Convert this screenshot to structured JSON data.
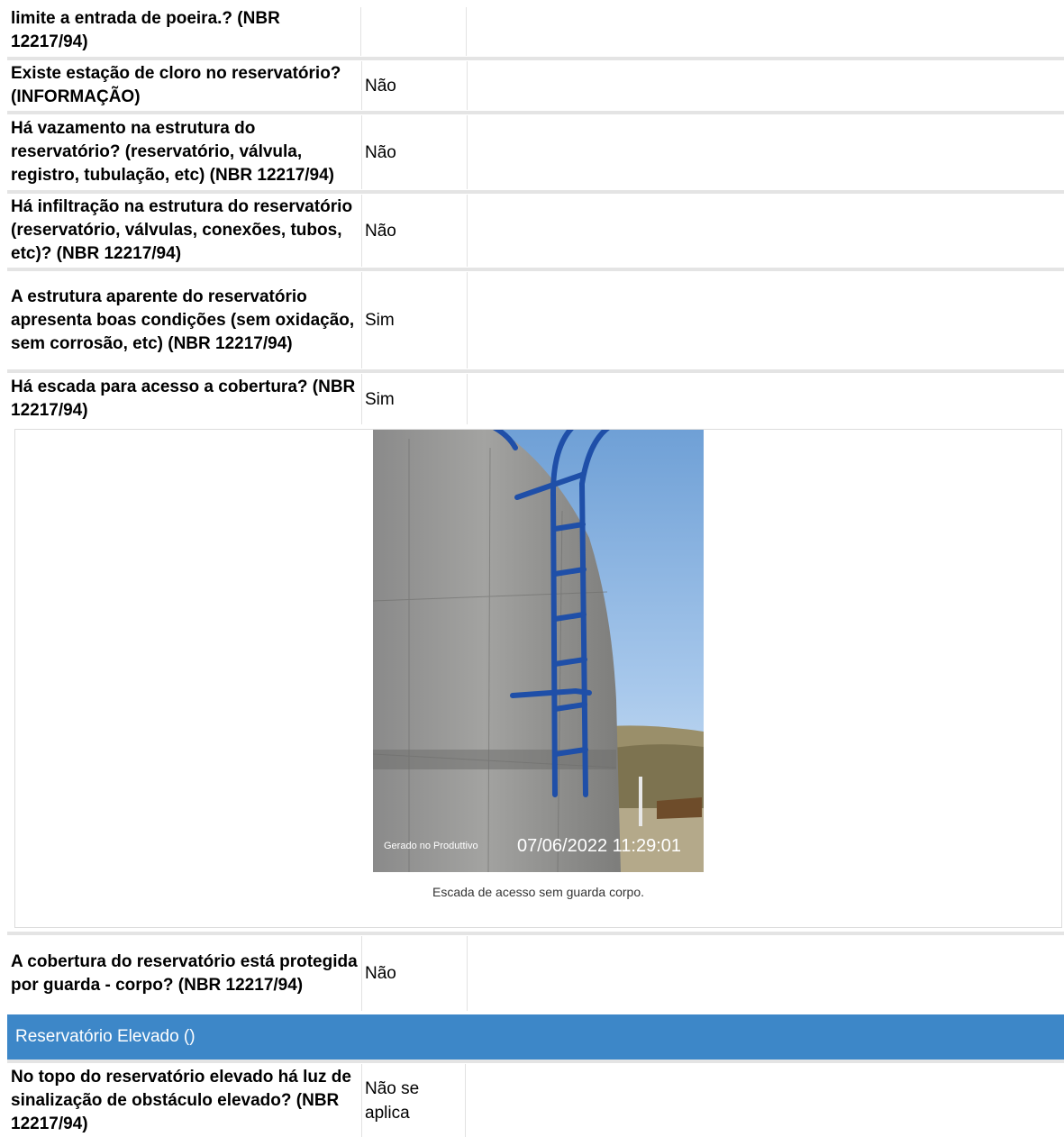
{
  "rows": [
    {
      "question": "limite a entrada de poeira.? (NBR 12217/94)",
      "answer": ""
    },
    {
      "question": "Existe estação de cloro no reservatório? (INFORMAÇÃO)",
      "answer": "Não"
    },
    {
      "question": "Há vazamento na estrutura do reservatório? (reservatório, válvula, registro, tubulação, etc) (NBR 12217/94)",
      "answer": "Não"
    },
    {
      "question": "Há infiltração na estrutura do reservatório (reservatório, válvulas, conexões, tubos, etc)? (NBR 12217/94)",
      "answer": "Não"
    },
    {
      "question": "A estrutura aparente do reservatório apresenta boas condições (sem oxidação, sem corrosão, etc) (NBR 12217/94)",
      "answer": "Sim"
    },
    {
      "question": "Há escada para acesso a cobertura? (NBR 12217/94)",
      "answer": "Sim"
    },
    {
      "question": "A cobertura do reservatório está protegida por guarda - corpo? (NBR 12217/94)",
      "answer": "Não"
    },
    {
      "question": "No topo do reservatório elevado há luz de sinalização de obstáculo elevado? (NBR 12217/94)",
      "answer": "Não se aplica"
    }
  ],
  "photo": {
    "watermark": "Gerado no Produttivo",
    "timestamp": "07/06/2022 11:29:01",
    "caption": "Escada de acesso sem guarda corpo."
  },
  "section": {
    "title": "Reservatório Elevado ()"
  },
  "colors": {
    "section_bg": "#3d87c8",
    "separator": "#e4e4e4",
    "ladder": "#1f4fa8"
  }
}
